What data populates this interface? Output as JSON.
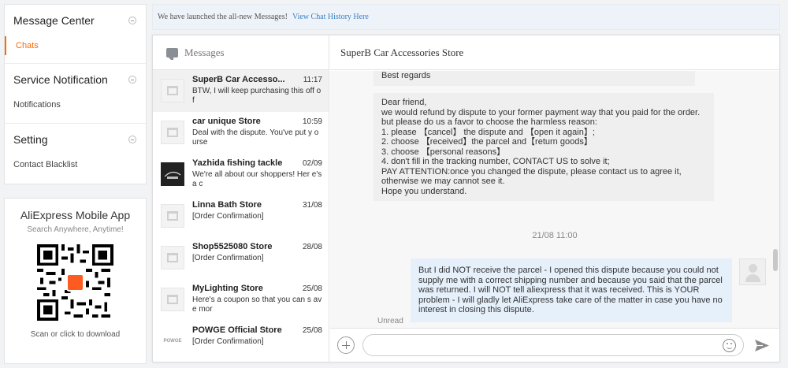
{
  "nav": {
    "sections": [
      {
        "title": "Message Center",
        "items": [
          {
            "label": "Chats",
            "active": true
          }
        ]
      },
      {
        "title": "Service Notification",
        "items": [
          {
            "label": "Notifications",
            "active": false
          }
        ]
      },
      {
        "title": "Setting",
        "items": [
          {
            "label": "Contact Blacklist",
            "active": false
          }
        ]
      }
    ],
    "accent_color": "#ff6a00"
  },
  "app_promo": {
    "title": "AliExpress Mobile App",
    "subtitle": "Search Anywhere, Anytime!",
    "download": "Scan or click to download"
  },
  "banner": {
    "text": "We have launched the all-new Messages!",
    "link": "View Chat History Here"
  },
  "messages_panel": {
    "title": "Messages",
    "conversations": [
      {
        "name": "SuperB Car Accesso...",
        "time": "11:17",
        "preview": "BTW, I will keep purchasing this off of",
        "avatar": "store-icon",
        "selected": true
      },
      {
        "name": "car unique Store",
        "time": "10:59",
        "preview": "Deal with the dispute. You've put y ourse",
        "avatar": "store-icon",
        "selected": false
      },
      {
        "name": "Yazhida fishing tackle",
        "time": "02/09",
        "preview": "We're all about our shoppers! Her e's a c",
        "avatar": "dark-logo",
        "selected": false
      },
      {
        "name": "Linna Bath Store",
        "time": "31/08",
        "preview": "[Order Confirmation]",
        "avatar": "store-icon",
        "selected": false
      },
      {
        "name": "Shop5525080 Store",
        "time": "28/08",
        "preview": "[Order Confirmation]",
        "avatar": "store-icon",
        "selected": false
      },
      {
        "name": "MyLighting Store",
        "time": "25/08",
        "preview": "Here's a coupon so that you can s ave mor",
        "avatar": "store-icon",
        "selected": false
      },
      {
        "name": "POWGE Official Store",
        "time": "25/08",
        "preview": "[Order Confirmation]",
        "avatar": "POWGE",
        "selected": false
      }
    ]
  },
  "chat": {
    "store_name": "SuperB Car Accessories Store",
    "incoming_1": "Best regards",
    "incoming_2": [
      "Dear friend,",
      "we would refund by dispute to your former payment way that you paid for the order.",
      "but please do us a favor to choose the harmless reason:",
      "1. please 【cancel】 the dispute and 【open it again】;",
      "2. choose 【received】the parcel and【return goods】",
      "3. choose 【personal reasons】",
      "4. don't fill in the tracking number, CONTACT US to solve it;",
      "PAY ATTENTION:once you changed the dispute, please contact us to agree it,",
      "otherwise we may cannot see it.",
      "Hope you understand."
    ],
    "date_separator": "21/08 11:00",
    "outgoing": "But I did NOT receive the parcel - I opened this dispute because you could not supply me with a correct shipping number and because you said that the parcel was returned. I will NOT tell aliexpress that it was received. This is YOUR problem - I will gladly let AliExpress take care of the matter in case you have no interest in closing this dispute.",
    "unread_label": "Unread",
    "input_placeholder": ""
  },
  "icons": [
    "collapse-icon",
    "qr-code",
    "messages-icon",
    "store-icon",
    "plus-icon",
    "emoji-icon",
    "send-icon",
    "user-avatar"
  ]
}
